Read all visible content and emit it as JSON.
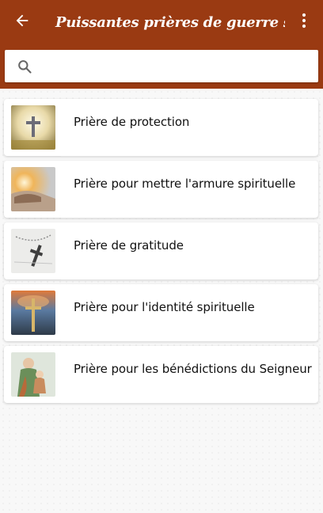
{
  "appbar": {
    "title": "Puissantes prières de guerre spirituel...",
    "back_icon": "arrow-left-icon",
    "menu_icon": "more-vert-icon",
    "color": "#9a3a12"
  },
  "search": {
    "icon": "search-icon",
    "value": "",
    "placeholder": ""
  },
  "prayers": [
    {
      "label": "Prière de protection",
      "thumb": "cross-light"
    },
    {
      "label": "Prière pour mettre l'armure spirituelle",
      "thumb": "hands-light"
    },
    {
      "label": "Prière de gratitude",
      "thumb": "rosary"
    },
    {
      "label": "Prière pour l'identité spirituelle",
      "thumb": "cross-sunset"
    },
    {
      "label": "Prière pour les bénédictions du Seigneur",
      "thumb": "saint-joseph"
    }
  ]
}
